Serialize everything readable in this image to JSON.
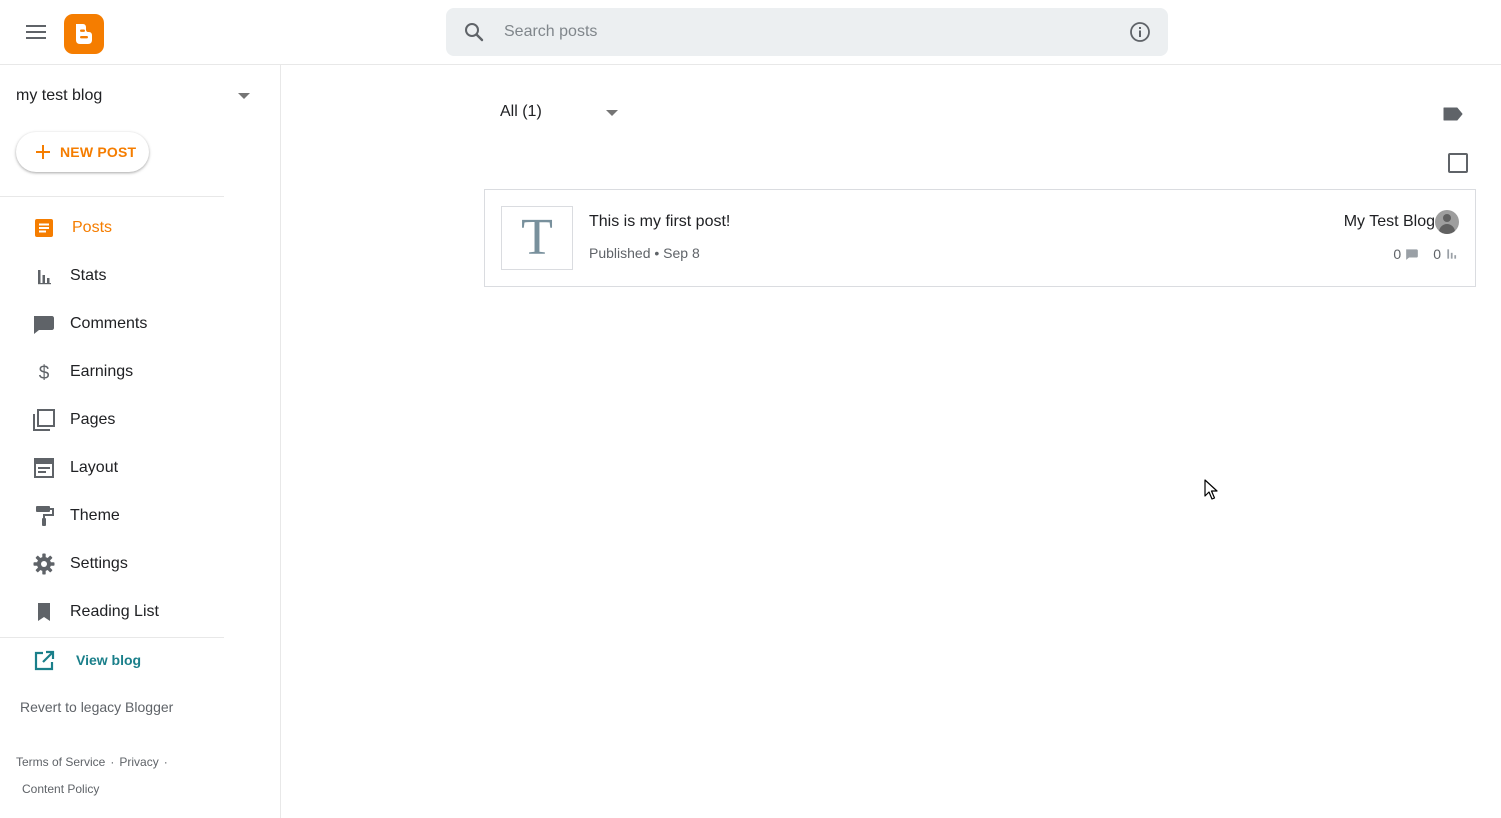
{
  "header": {
    "menu_icon": "hamburger-menu-icon",
    "logo_icon": "blogger-logo-icon",
    "search": {
      "placeholder": "Search posts",
      "value": ""
    }
  },
  "sidebar": {
    "blog_name": "my test blog",
    "new_post_label": "NEW POST",
    "items": [
      {
        "label": "Posts",
        "icon": "posts-icon",
        "active": true
      },
      {
        "label": "Stats",
        "icon": "stats-icon",
        "active": false
      },
      {
        "label": "Comments",
        "icon": "comments-icon",
        "active": false
      },
      {
        "label": "Earnings",
        "icon": "dollar-icon",
        "active": false
      },
      {
        "label": "Pages",
        "icon": "pages-icon",
        "active": false
      },
      {
        "label": "Layout",
        "icon": "layout-icon",
        "active": false
      },
      {
        "label": "Theme",
        "icon": "paint-roller-icon",
        "active": false
      },
      {
        "label": "Settings",
        "icon": "gear-icon",
        "active": false
      },
      {
        "label": "Reading List",
        "icon": "bookmark-icon",
        "active": false
      }
    ],
    "view_blog_label": "View blog",
    "revert_label": "Revert to legacy Blogger",
    "footer": {
      "terms": "Terms of Service",
      "privacy": "Privacy",
      "content_policy": "Content Policy",
      "separator": "·"
    }
  },
  "main": {
    "filter_label": "All (1)",
    "posts": [
      {
        "thumb_letter": "T",
        "title": "This is my first post!",
        "meta": "Published • Sep 8",
        "blog": "My Test Blog",
        "comments": "0",
        "views": "0"
      }
    ]
  },
  "colors": {
    "accent": "#f57d00",
    "link": "#1a7f8a",
    "search_bg": "#eceff1"
  }
}
